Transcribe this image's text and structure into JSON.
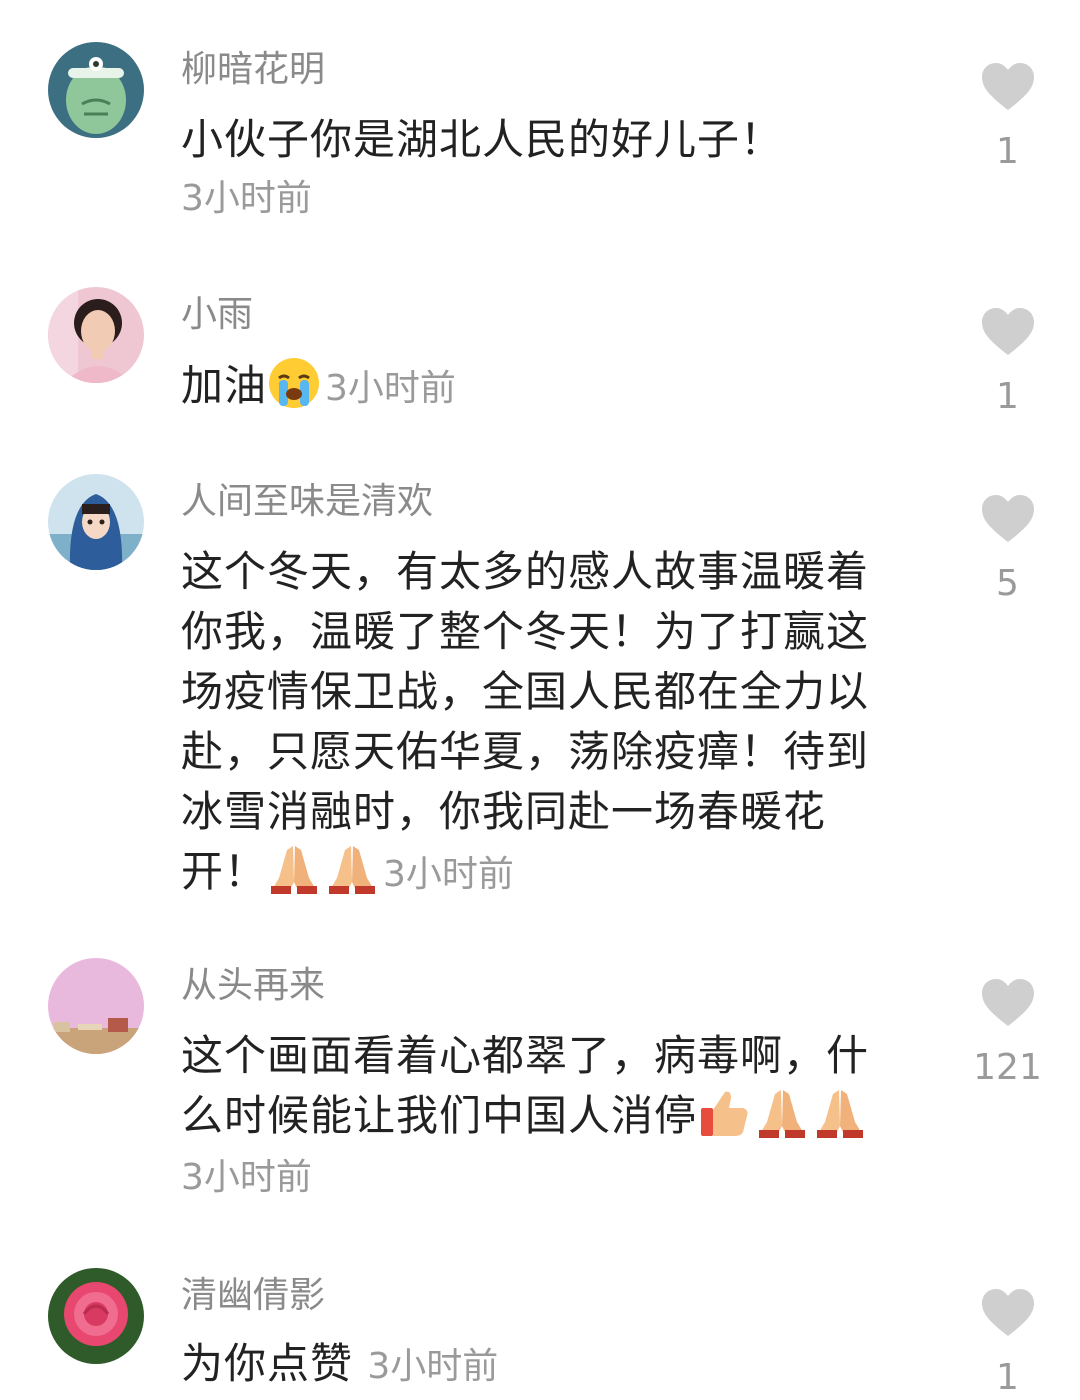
{
  "colors": {
    "heart": "#cfcfcf",
    "username": "#8a8a8a",
    "text": "#222222",
    "time": "#9a9a9a"
  },
  "comments": [
    {
      "user": "柳暗花明",
      "avatar": "green-monster-avatar",
      "text": "小伙子你是湖北人民的好儿子！",
      "time": "3小时前",
      "likes": "1"
    },
    {
      "user": "小雨",
      "avatar": "woman-portrait-avatar",
      "text": "加油",
      "emoji": [
        "crying-face-emoji"
      ],
      "time": "3小时前",
      "likes": "1"
    },
    {
      "user": "人间至味是清欢",
      "avatar": "girl-blue-scarf-avatar",
      "text_lines": [
        "这个冬天，有太多的感人故事温暖着",
        "你我，温暖了整个冬天！为了打赢这",
        "场疫情保卫战，全国人民都在全力以",
        "赴，只愿天佑华夏，荡除疫瘴！待到",
        "冰雪消融时，你我同赴一场春暖花",
        "开！"
      ],
      "emoji": [
        "folded-hands-emoji",
        "folded-hands-emoji"
      ],
      "time": "3小时前",
      "likes": "5"
    },
    {
      "user": "从头再来",
      "avatar": "pink-sky-avatar",
      "text_lines": [
        "这个画面看着心都翠了，病毒啊，什",
        "么时候能让我们中国人消停"
      ],
      "emoji": [
        "thumbs-up-emoji",
        "folded-hands-emoji",
        "folded-hands-emoji"
      ],
      "time": "3小时前",
      "likes": "121"
    },
    {
      "user": "清幽倩影",
      "avatar": "pink-rose-avatar",
      "text": "为你点赞",
      "time": "3小时前",
      "likes": "1"
    }
  ]
}
